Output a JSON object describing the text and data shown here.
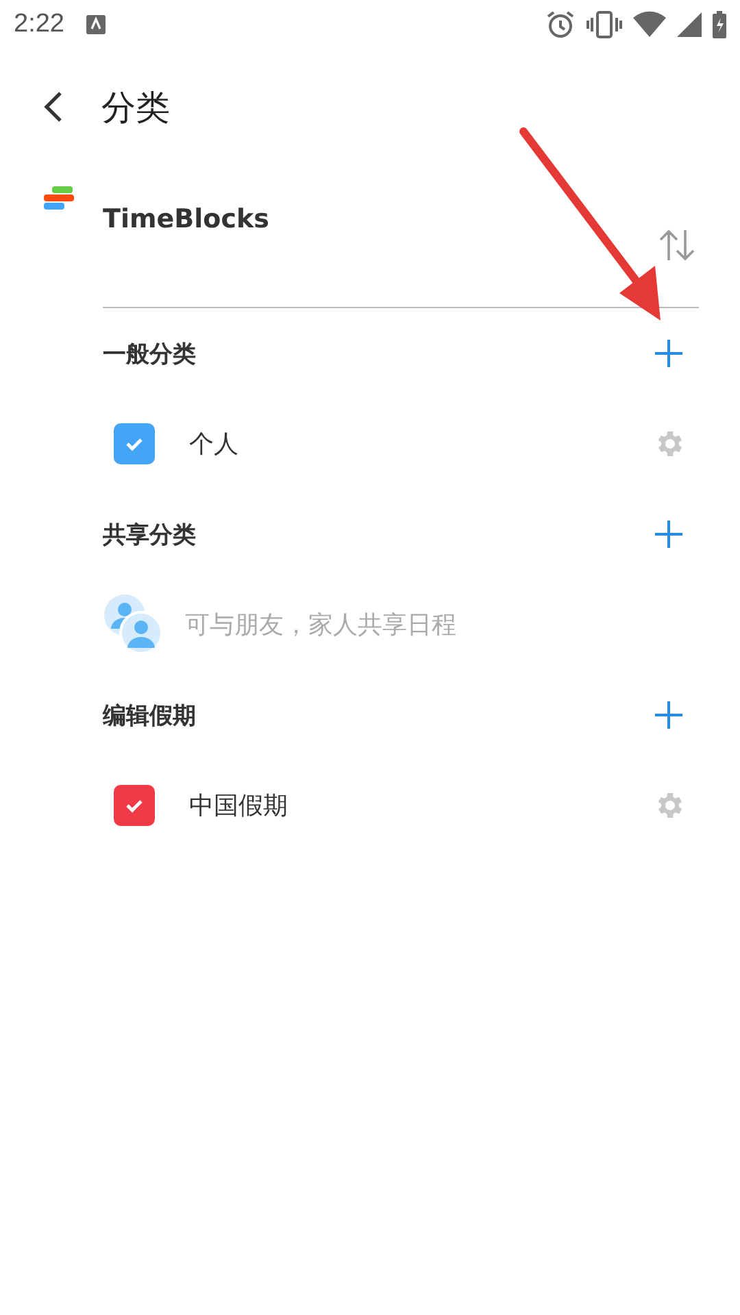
{
  "status_bar": {
    "time": "2:22"
  },
  "header": {
    "title": "分类"
  },
  "account": {
    "name": "TimeBlocks"
  },
  "sections": [
    {
      "title": "一般分类",
      "items": [
        {
          "kind": "category",
          "label": "个人",
          "checked": true,
          "color": "#42a5f5"
        }
      ]
    },
    {
      "title": "共享分类",
      "items": [
        {
          "kind": "hint",
          "label": "可与朋友，家人共享日程"
        }
      ]
    },
    {
      "title": "编辑假期",
      "items": [
        {
          "kind": "category",
          "label": "中国假期",
          "checked": true,
          "color": "#f03a47"
        }
      ]
    }
  ]
}
